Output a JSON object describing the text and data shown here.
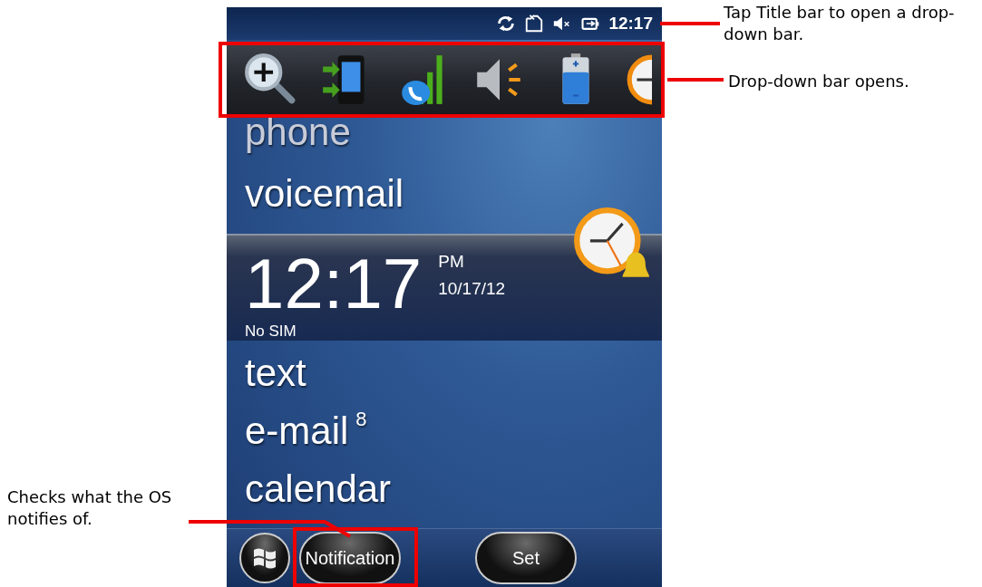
{
  "title_bar": {
    "time": "12:17"
  },
  "home_items": [
    {
      "kind": "link",
      "label": "phone"
    },
    {
      "kind": "link",
      "label": "voicemail"
    },
    {
      "kind": "clock",
      "time": "12:17",
      "period": "PM",
      "date": "10/17/12",
      "carrier": "No SIM"
    },
    {
      "kind": "link",
      "label": "text"
    },
    {
      "kind": "link",
      "label": "e-mail",
      "count": "8"
    },
    {
      "kind": "link",
      "label": "calendar"
    }
  ],
  "softkeys": [
    "Notification",
    "Set"
  ],
  "right_notes": [
    "Tap Title bar to open a drop-down bar.",
    "Drop-down bar opens."
  ],
  "left_notes": [
    "Checks what the OS notifies of."
  ]
}
